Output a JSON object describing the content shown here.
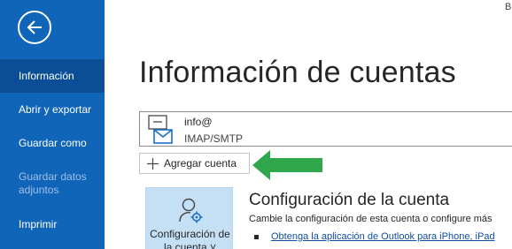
{
  "sidebar": {
    "items": [
      {
        "label": "Información",
        "active": true
      },
      {
        "label": "Abrir y exportar"
      },
      {
        "label": "Guardar como"
      },
      {
        "label": "Guardar datos adjuntos",
        "disabled": true
      },
      {
        "label": "Imprimir"
      }
    ]
  },
  "top_right": "B",
  "page": {
    "title": "Información de cuentas"
  },
  "account": {
    "email": "info@",
    "type": "IMAP/SMTP"
  },
  "add_account": {
    "label": "Agregar cuenta"
  },
  "settings": {
    "tile_label": "Configuración de la cuenta ˅",
    "title": "Configuración de la cuenta",
    "description": "Cambie la configuración de esta cuenta o configure más",
    "link": "Obtenga la aplicación de Outlook para iPhone, iPad"
  },
  "colors": {
    "sidebar_bg": "#1065b9",
    "sidebar_active": "#0a4f96",
    "tile_bg": "#c5e0f5",
    "annotation_arrow": "#2ea84a",
    "link": "#0f4fa8"
  },
  "icons": {
    "back": "back-arrow-icon",
    "account": "mail-account-icon",
    "add": "plus-icon",
    "settings": "user-gear-icon"
  }
}
